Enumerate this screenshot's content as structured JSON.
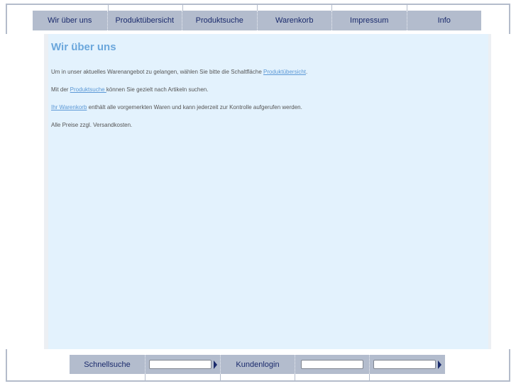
{
  "nav": {
    "tabs": [
      {
        "label": "Wir über uns"
      },
      {
        "label": "Produktübersicht"
      },
      {
        "label": "Produktsuche"
      },
      {
        "label": "Warenkorb"
      },
      {
        "label": "Impressum"
      },
      {
        "label": "Info"
      }
    ]
  },
  "content": {
    "title": "Wir über uns",
    "p1_before": "Um in unser aktuelles Warenangebot zu gelangen, wählen Sie bitte die Schaltfläche ",
    "p1_link": "Produktübersicht",
    "p1_after": ".",
    "p2_before": "Mit der ",
    "p2_link": "Produktsuche ",
    "p2_after": "können Sie gezielt nach Artikeln suchen.",
    "p3_link": "Ihr Warenkorb",
    "p3_after": " enthält alle vorgemerkten Waren und kann jederzeit zur Kontrolle aufgerufen werden.",
    "p4": "Alle Preise zzgl. Versandkosten."
  },
  "footer": {
    "quicksearch_label": "Schnellsuche",
    "quicksearch_value": "",
    "login_label": "Kundenlogin",
    "login_user_value": "",
    "login_password_value": ""
  },
  "colors": {
    "nav_bg": "#b3bccd",
    "nav_text": "#1a2a6c",
    "content_bg": "#e3f2fd",
    "title": "#6ba7dc",
    "link": "#5b98d6"
  }
}
